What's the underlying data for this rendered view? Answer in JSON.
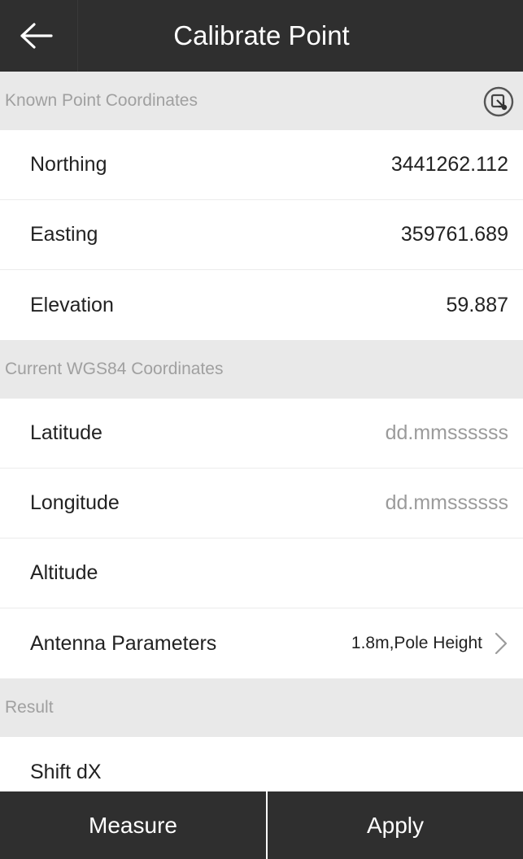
{
  "header": {
    "title": "Calibrate Point"
  },
  "known": {
    "section_label": "Known Point Coordinates",
    "rows": [
      {
        "label": "Northing",
        "value": "3441262.112"
      },
      {
        "label": "Easting",
        "value": "359761.689"
      },
      {
        "label": "Elevation",
        "value": "59.887"
      }
    ]
  },
  "current": {
    "section_label": "Current WGS84 Coordinates",
    "rows": [
      {
        "label": "Latitude",
        "placeholder": "dd.mmssssss"
      },
      {
        "label": "Longitude",
        "placeholder": "dd.mmssssss"
      },
      {
        "label": "Altitude",
        "value": ""
      }
    ],
    "antenna": {
      "label": "Antenna Parameters",
      "value": "1.8m,Pole Height"
    }
  },
  "result": {
    "section_label": "Result",
    "rows": [
      {
        "label": "Shift dX",
        "value": ""
      }
    ]
  },
  "footer": {
    "measure_label": "Measure",
    "apply_label": "Apply"
  },
  "icons": {
    "back": "arrow-left-icon",
    "import": "import-point-icon",
    "chevron": "chevron-right-icon"
  },
  "colors": {
    "header_bg": "#2f2f2f",
    "section_bg": "#e9e9e9",
    "placeholder": "#9b9b9b"
  }
}
